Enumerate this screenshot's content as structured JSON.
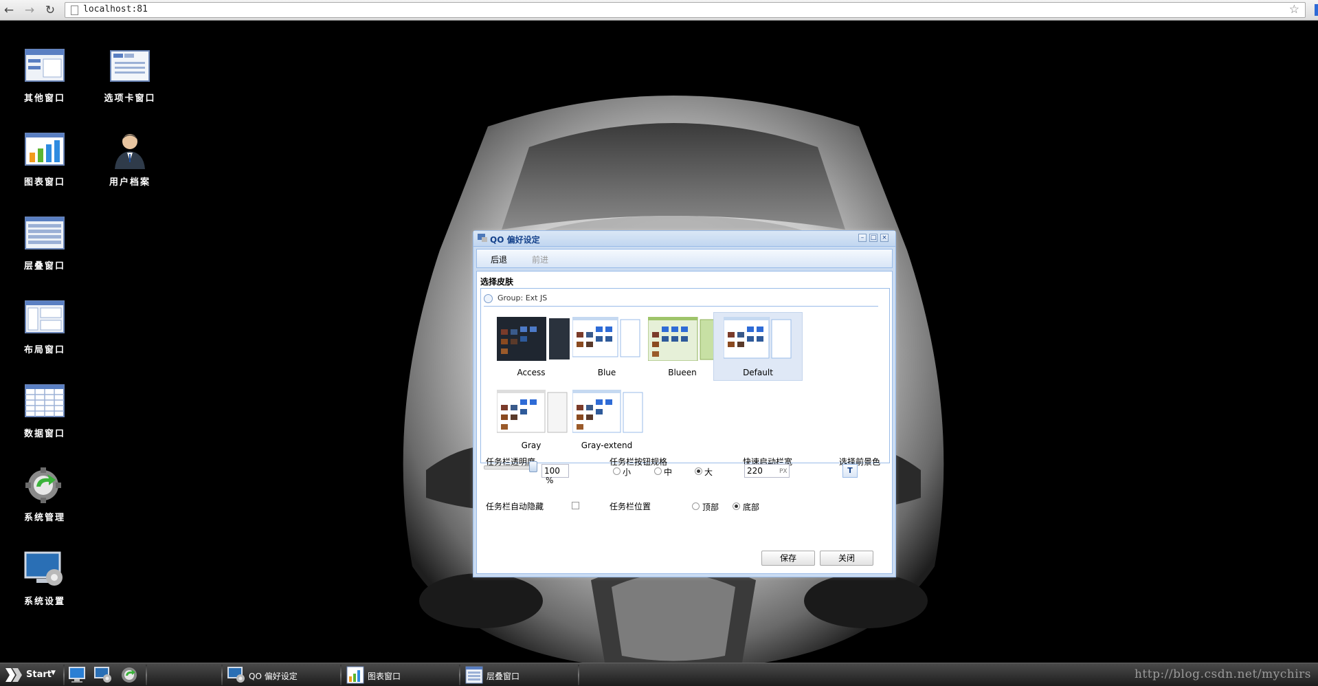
{
  "browser": {
    "back_icon": "back-arrow-icon",
    "forward_icon": "forward-arrow-icon",
    "reload_icon": "reload-icon",
    "url": "localhost:81",
    "bookmark_icon": "star-icon"
  },
  "desktop": {
    "icons": [
      {
        "label": "其他窗口",
        "icon": "window-icon"
      },
      {
        "label": "选项卡窗口",
        "icon": "tabs-window-icon"
      },
      {
        "label": "图表窗口",
        "icon": "bar-chart-icon"
      },
      {
        "label": "用户档案",
        "icon": "user-icon"
      },
      {
        "label": "层叠窗口",
        "icon": "cascade-window-icon"
      },
      {
        "label": "布局窗口",
        "icon": "layout-window-icon"
      },
      {
        "label": "数据窗口",
        "icon": "grid-window-icon"
      },
      {
        "label": "系统管理",
        "icon": "gear-refresh-icon"
      },
      {
        "label": "系统设置",
        "icon": "monitor-gear-icon"
      }
    ]
  },
  "window": {
    "title": "QO 偏好设定",
    "toolbar": {
      "back": "后退",
      "forward": "前进"
    },
    "section_title": "选择皮肤",
    "group_label": "Group: Ext JS",
    "skins": [
      {
        "name": "Access",
        "theme": "#1f2630",
        "selected": false
      },
      {
        "name": "Blue",
        "theme": "#dfe8f6",
        "selected": false
      },
      {
        "name": "Blueen",
        "theme": "#c7e0a4",
        "selected": false
      },
      {
        "name": "Default",
        "theme": "#dfe8f6",
        "selected": true
      },
      {
        "name": "Gray",
        "theme": "#f0f0f0",
        "selected": false
      },
      {
        "name": "Gray-extend",
        "theme": "#dfe8f6",
        "selected": false
      }
    ],
    "options": {
      "transparency_label": "任务栏透明度",
      "transparency_value": "100",
      "transparency_unit": "%",
      "transparency_level": 1.0,
      "button_size_label": "任务栏按钮规格",
      "size_small": "小",
      "size_medium": "中",
      "size_large": "大",
      "size_selected": "large",
      "quickstart_label": "快速启动栏宽",
      "quickstart_value": "220",
      "quickstart_unit": "PX",
      "fg_color_label": "选择前景色",
      "fg_color_button": "T",
      "autohide_label": "任务栏自动隐藏",
      "autohide_checked": false,
      "position_label": "任务栏位置",
      "position_top": "顶部",
      "position_bottom": "底部",
      "position_selected": "bottom"
    },
    "buttons": {
      "save": "保存",
      "close": "关闭"
    }
  },
  "taskbar": {
    "start_label": "Start",
    "quick_launch": [
      "monitor-icon",
      "monitor-gear-icon",
      "gear-refresh-icon"
    ],
    "tasks": [
      {
        "label": "QO 偏好设定",
        "icon": "monitor-gear-icon"
      },
      {
        "label": "图表窗口",
        "icon": "bar-chart-icon"
      },
      {
        "label": "层叠窗口",
        "icon": "cascade-window-icon"
      }
    ],
    "watermark": "http://blog.csdn.net/mychirs"
  },
  "colors": {
    "ext_blue_border": "#99bbe8",
    "ext_title": "#15428b",
    "desktop_bg": "#000000"
  }
}
